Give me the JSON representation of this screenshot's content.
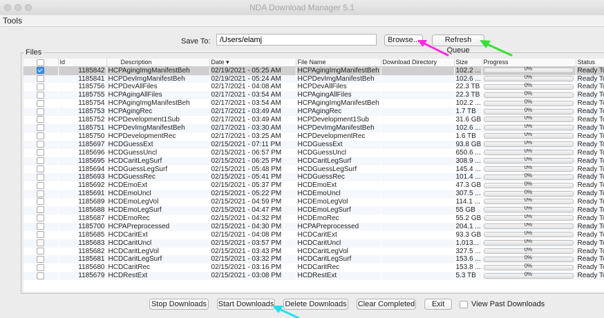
{
  "window": {
    "title": "NDA Download Manager 5.1"
  },
  "menubar": {
    "tools": "Tools"
  },
  "save_to": {
    "label": "Save To:",
    "value": "/Users/elamj"
  },
  "buttons": {
    "browse": "Browse...",
    "refresh_queue": "Refresh Queue",
    "stop_downloads": "Stop Downloads",
    "start_downloads": "Start Downloads",
    "delete_downloads": "Delete Downloads",
    "clear_completed": "Clear Completed",
    "exit": "Exit"
  },
  "view_past": {
    "label": "View Past Downloads",
    "checked": false
  },
  "files": {
    "legend": "Files",
    "columns": [
      "",
      "Id",
      "Description",
      "Date ▾",
      "File Name",
      "Download Directory",
      "Size",
      "Progress",
      "Status"
    ],
    "rows": [
      {
        "checked": true,
        "id": "1185842",
        "description": "HCPAgingImgManifestBeh",
        "date": "02/19/2021 - 05:25 AM",
        "file_name": "HCPAgingImgManifestBeh",
        "dir": "",
        "size": "102.2 ...",
        "progress": "0%",
        "status": "Ready To Download"
      },
      {
        "checked": false,
        "id": "1185841",
        "description": "HCPDevImgManifestBeh",
        "date": "02/19/2021 - 05:24 AM",
        "file_name": "HCPDevImgManifestBeh",
        "dir": "",
        "size": "102.6 ...",
        "progress": "0%",
        "status": "Ready To Download"
      },
      {
        "checked": false,
        "id": "1185756",
        "description": "HCPDevAllFiles",
        "date": "02/17/2021 - 04:08 AM",
        "file_name": "HCPDevAllFiles",
        "dir": "",
        "size": "22.3 TB",
        "progress": "0%",
        "status": "Ready To Download"
      },
      {
        "checked": false,
        "id": "1185755",
        "description": "HCPAgingAllFiles",
        "date": "02/17/2021 - 03:54 AM",
        "file_name": "HCPAgingAllFiles",
        "dir": "",
        "size": "22.3 TB",
        "progress": "0%",
        "status": "Ready To Download"
      },
      {
        "checked": false,
        "id": "1185754",
        "description": "HCPAgingImgManifestBeh",
        "date": "02/17/2021 - 03:54 AM",
        "file_name": "HCPAgingImgManifestBeh",
        "dir": "",
        "size": "102.2 ...",
        "progress": "0%",
        "status": "Ready To Download"
      },
      {
        "checked": false,
        "id": "1185753",
        "description": "HCPAgingRec",
        "date": "02/17/2021 - 03:49 AM",
        "file_name": "HCPAgingRec",
        "dir": "",
        "size": "1.7 TB",
        "progress": "0%",
        "status": "Ready To Download"
      },
      {
        "checked": false,
        "id": "1185752",
        "description": "HCPDevelopment1Sub",
        "date": "02/17/2021 - 03:49 AM",
        "file_name": "HCPDevelopment1Sub",
        "dir": "",
        "size": "31.6 GB",
        "progress": "0%",
        "status": "Ready To Download"
      },
      {
        "checked": false,
        "id": "1185751",
        "description": "HCPDevImgManifestBeh",
        "date": "02/17/2021 - 03:30 AM",
        "file_name": "HCPDevImgManifestBeh",
        "dir": "",
        "size": "102.6 ...",
        "progress": "0%",
        "status": "Ready To Download"
      },
      {
        "checked": false,
        "id": "1185750",
        "description": "HCPDevelopmentRec",
        "date": "02/17/2021 - 03:25 AM",
        "file_name": "HCPDevelopmentRec",
        "dir": "",
        "size": "1.6 TB",
        "progress": "0%",
        "status": "Ready To Download"
      },
      {
        "checked": false,
        "id": "1185697",
        "description": "HCDGuessExt",
        "date": "02/15/2021 - 07:11 PM",
        "file_name": "HCDGuessExt",
        "dir": "",
        "size": "93.8 GB",
        "progress": "0%",
        "status": "Ready To Download"
      },
      {
        "checked": false,
        "id": "1185696",
        "description": "HCDGuessUncl",
        "date": "02/15/2021 - 06:57 PM",
        "file_name": "HCDGuessUncl",
        "dir": "",
        "size": "650.6 ...",
        "progress": "0%",
        "status": "Ready To Download"
      },
      {
        "checked": false,
        "id": "1185695",
        "description": "HCDCaritLegSurf",
        "date": "02/15/2021 - 06:25 PM",
        "file_name": "HCDCaritLegSurf",
        "dir": "",
        "size": "308.9 ...",
        "progress": "0%",
        "status": "Ready To Download"
      },
      {
        "checked": false,
        "id": "1185694",
        "description": "HCDGuessLegSurf",
        "date": "02/15/2021 - 05:48 PM",
        "file_name": "HCDGuessLegSurf",
        "dir": "",
        "size": "145.4 ...",
        "progress": "0%",
        "status": "Ready To Download"
      },
      {
        "checked": false,
        "id": "1185693",
        "description": "HCDGuessRec",
        "date": "02/15/2021 - 05:41 PM",
        "file_name": "HCDGuessRec",
        "dir": "",
        "size": "101.4 ...",
        "progress": "0%",
        "status": "Ready To Download"
      },
      {
        "checked": false,
        "id": "1185692",
        "description": "HCDEmoExt",
        "date": "02/15/2021 - 05:37 PM",
        "file_name": "HCDEmoExt",
        "dir": "",
        "size": "47.3 GB",
        "progress": "0%",
        "status": "Ready To Download"
      },
      {
        "checked": false,
        "id": "1185691",
        "description": "HCDEmoUncl",
        "date": "02/15/2021 - 05:22 PM",
        "file_name": "HCDEmoUncl",
        "dir": "",
        "size": "307.5 ...",
        "progress": "0%",
        "status": "Ready To Download"
      },
      {
        "checked": false,
        "id": "1185689",
        "description": "HCDEmoLegVol",
        "date": "02/15/2021 - 04:59 PM",
        "file_name": "HCDEmoLegVol",
        "dir": "",
        "size": "114.1 ...",
        "progress": "0%",
        "status": "Ready To Download"
      },
      {
        "checked": false,
        "id": "1185688",
        "description": "HCDEmoLegSurf",
        "date": "02/15/2021 - 04:47 PM",
        "file_name": "HCDEmoLegSurf",
        "dir": "",
        "size": "55 GB",
        "progress": "0%",
        "status": "Ready To Download"
      },
      {
        "checked": false,
        "id": "1185687",
        "description": "HCDEmoRec",
        "date": "02/15/2021 - 04:32 PM",
        "file_name": "HCDEmoRec",
        "dir": "",
        "size": "55.2 GB",
        "progress": "0%",
        "status": "Ready To Download"
      },
      {
        "checked": false,
        "id": "1185700",
        "description": "HCPAPreprocessed",
        "date": "02/15/2021 - 04:30 PM",
        "file_name": "HCPAPreprocessed",
        "dir": "",
        "size": "204.1 ...",
        "progress": "0%",
        "status": "Ready To Download"
      },
      {
        "checked": false,
        "id": "1185685",
        "description": "HCDCaritExt",
        "date": "02/15/2021 - 04:08 PM",
        "file_name": "HCDCaritExt",
        "dir": "",
        "size": "93.3 GB",
        "progress": "0%",
        "status": "Ready To Download"
      },
      {
        "checked": false,
        "id": "1185683",
        "description": "HCDCaritUncl",
        "date": "02/15/2021 - 03:57 PM",
        "file_name": "HCDCaritUncl",
        "dir": "",
        "size": "1,013...",
        "progress": "0%",
        "status": "Ready To Download"
      },
      {
        "checked": false,
        "id": "1185682",
        "description": "HCDCaritLegVol",
        "date": "02/15/2021 - 03:43 PM",
        "file_name": "HCDCaritLegVol",
        "dir": "",
        "size": "327.5 ...",
        "progress": "0%",
        "status": "Ready To Download"
      },
      {
        "checked": false,
        "id": "1185681",
        "description": "HCDCaritLegSurf",
        "date": "02/15/2021 - 03:32 PM",
        "file_name": "HCDCaritLegSurf",
        "dir": "",
        "size": "153.6 ...",
        "progress": "0%",
        "status": "Ready To Download"
      },
      {
        "checked": false,
        "id": "1185680",
        "description": "HCDCaritRec",
        "date": "02/15/2021 - 03:16 PM",
        "file_name": "HCDCaritRec",
        "dir": "",
        "size": "153.8 ...",
        "progress": "0%",
        "status": "Ready To Download"
      },
      {
        "checked": false,
        "id": "1185679",
        "description": "HCDRestExt",
        "date": "02/15/2021 - 03:08 PM",
        "file_name": "HCDRestExt",
        "dir": "",
        "size": "5.3 TB",
        "progress": "0%",
        "status": "Ready To Download"
      }
    ]
  },
  "annotation_colors": {
    "magenta": "#ff28e6",
    "green": "#33e233",
    "cyan": "#22e0ee"
  }
}
